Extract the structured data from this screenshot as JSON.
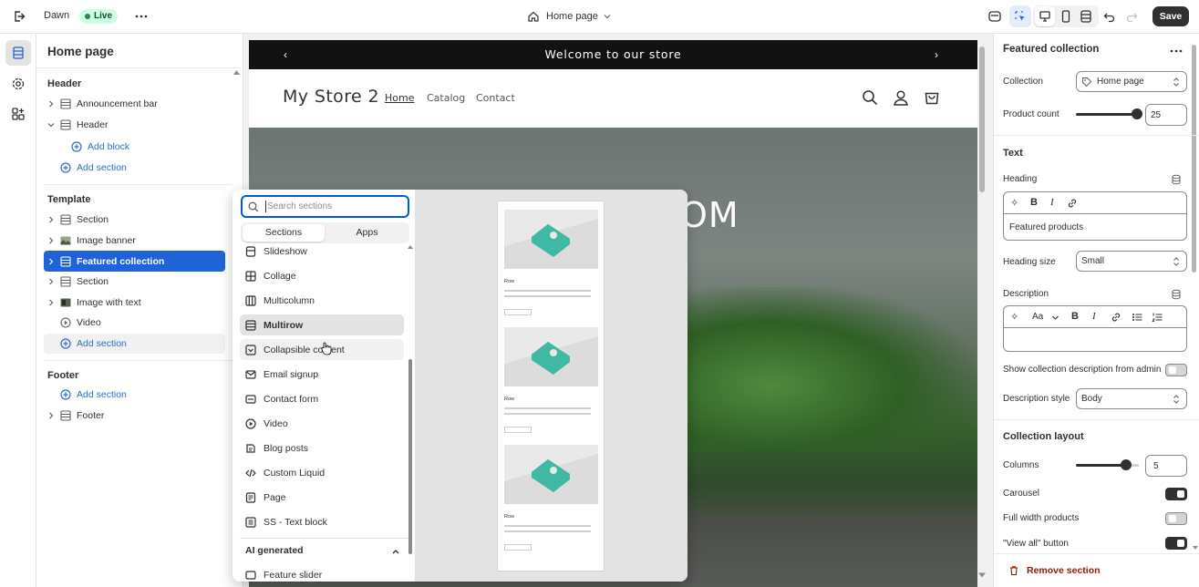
{
  "topbar": {
    "store_name": "Dawn",
    "live_badge": "Live",
    "page_selector": "Home page",
    "save_label": "Save"
  },
  "left_panel": {
    "title": "Home page",
    "header_group": "Header",
    "announcement_bar": "Announcement bar",
    "header": "Header",
    "add_block": "Add block",
    "add_section_header": "Add section",
    "template_group": "Template",
    "template_items": [
      "Section",
      "Image banner",
      "Featured collection",
      "Section",
      "Image with text",
      "Video"
    ],
    "add_section_template": "Add section",
    "footer_group": "Footer",
    "add_section_footer": "Add section",
    "footer": "Footer"
  },
  "preview": {
    "announcement": "Welcome to our store",
    "store_title": "My Store 2",
    "nav": [
      "Home",
      "Catalog",
      "Contact"
    ],
    "hero_text_partial": "OM"
  },
  "section_picker": {
    "search_placeholder": "Search sections",
    "tabs": [
      "Sections",
      "Apps"
    ],
    "items": [
      "Slideshow",
      "Collage",
      "Multicolumn",
      "Multirow",
      "Collapsible content",
      "Email signup",
      "Contact form",
      "Video",
      "Blog posts",
      "Custom Liquid",
      "Page",
      "SS - Text block"
    ],
    "ai_group": "AI generated",
    "ai_items": [
      "Feature slider"
    ],
    "preview_row_title": "Row"
  },
  "settings": {
    "title": "Featured collection",
    "collection_label": "Collection",
    "collection_value": "Home page",
    "product_count_label": "Product count",
    "product_count_value": "25",
    "product_count_level": 0.96,
    "text_group": "Text",
    "heading_label": "Heading",
    "heading_value": "Featured products",
    "heading_size_label": "Heading size",
    "heading_size_value": "Small",
    "description_label": "Description",
    "show_desc_label": "Show collection description from admin",
    "description_style_label": "Description style",
    "description_style_value": "Body",
    "layout_group": "Collection layout",
    "columns_label": "Columns",
    "columns_value": "5",
    "columns_level": 0.8,
    "carousel_label": "Carousel",
    "full_width_label": "Full width products",
    "view_all_label": "\"View all\" button",
    "remove_label": "Remove section"
  },
  "colors": {
    "accent": "#1f63d8",
    "live_green": "#29845a",
    "live_bg": "#cdfee1",
    "announcement_bg": "#121212",
    "remove_red": "#8e1f0b"
  }
}
